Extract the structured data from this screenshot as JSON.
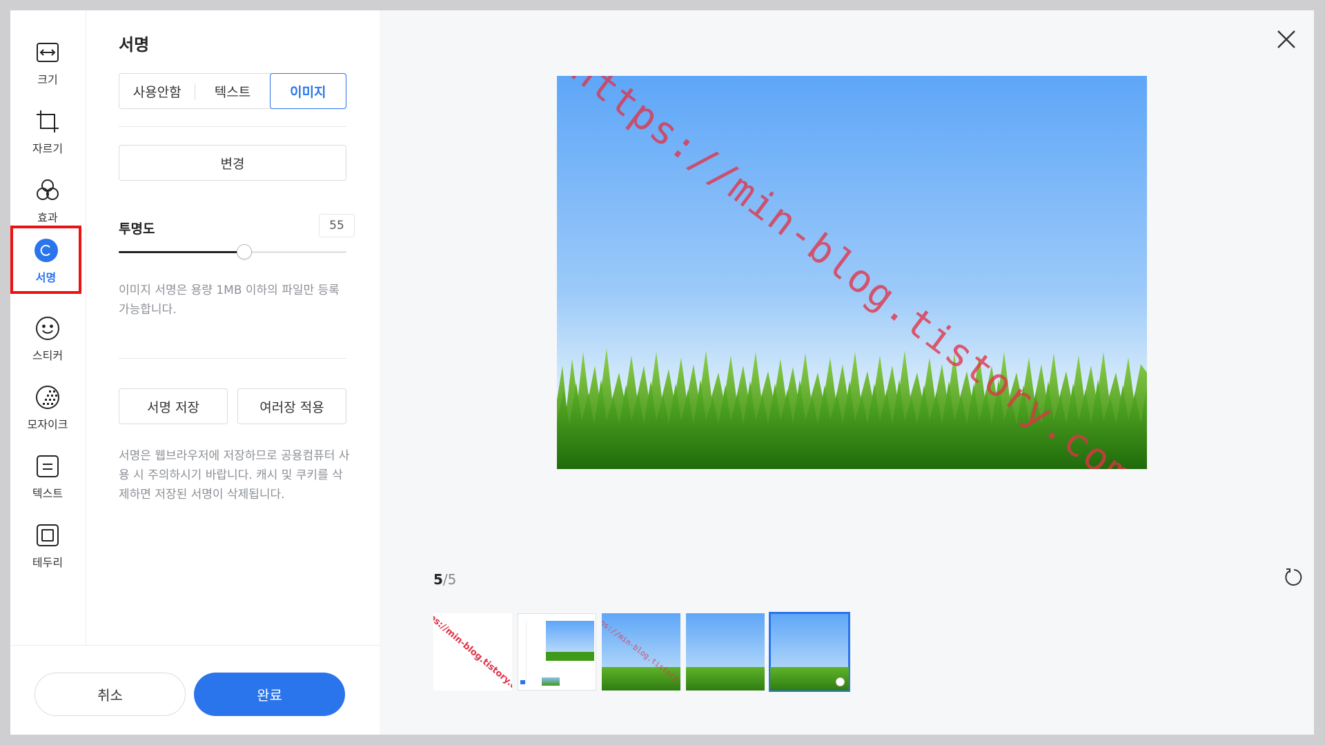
{
  "tools": [
    {
      "label": "크기",
      "icon": "resize-icon"
    },
    {
      "label": "자르기",
      "icon": "crop-icon"
    },
    {
      "label": "효과",
      "icon": "effects-icon"
    },
    {
      "label": "서명",
      "icon": "signature-icon",
      "active": true
    },
    {
      "label": "스티커",
      "icon": "sticker-icon"
    },
    {
      "label": "모자이크",
      "icon": "mosaic-icon"
    },
    {
      "label": "텍스트",
      "icon": "text-icon"
    },
    {
      "label": "테두리",
      "icon": "border-icon"
    }
  ],
  "panel": {
    "title": "서명",
    "segments": [
      "사용안함",
      "텍스트",
      "이미지"
    ],
    "selected_segment": "이미지",
    "change_button": "변경",
    "opacity_label": "투명도",
    "opacity_value": "55",
    "opacity_percent": 55,
    "note1": "이미지 서명은 용량 1MB 이하의 파일만 등록 가능합니다.",
    "save_signature_button": "서명 저장",
    "apply_multiple_button": "여러장 적용",
    "note2": "서명은 웹브라우저에 저장하므로 공용컴퓨터 사용 시 주의하시기 바랍니다. 캐시 및 쿠키를 삭제하면 저장된 서명이 삭제됩니다."
  },
  "footer": {
    "cancel": "취소",
    "done": "완료"
  },
  "preview": {
    "watermark": "https://min-blog.tistory.com"
  },
  "pager": {
    "current": "5",
    "total": "/5"
  },
  "thumbnails": {
    "count": 5,
    "selected_index": 4,
    "thumb1_text": "https://min-blog.tistory.com"
  },
  "colors": {
    "accent": "#2a74ec",
    "highlight_box": "#ee1111",
    "watermark": "#e23246"
  }
}
